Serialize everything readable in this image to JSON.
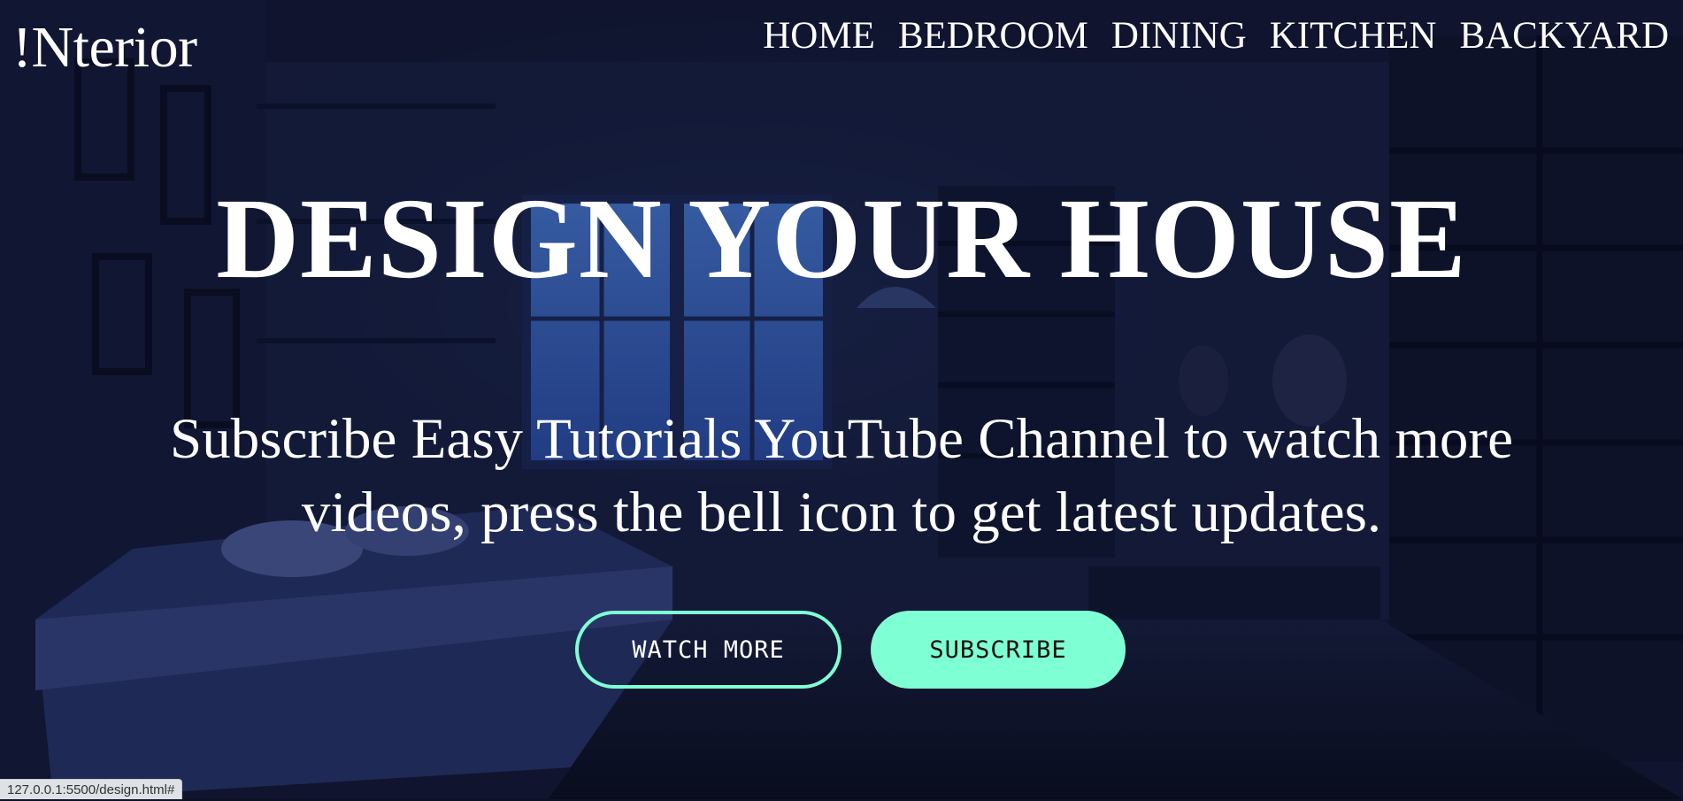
{
  "header": {
    "logo": "!Nterior",
    "nav": [
      {
        "label": "HOME"
      },
      {
        "label": "BEDROOM"
      },
      {
        "label": "DINING"
      },
      {
        "label": "KITCHEN"
      },
      {
        "label": "BACKYARD"
      }
    ]
  },
  "hero": {
    "title": "DESIGN YOUR HOUSE",
    "subtitle_line1": "Subscribe Easy Tutorials YouTube Channel to watch more",
    "subtitle_line2": "videos, press the bell icon to get latest updates.",
    "buttons": {
      "watch_more": "WATCH MORE",
      "subscribe": "SUBSCRIBE"
    }
  },
  "status_bar": {
    "url": "127.0.0.1:5500/design.html#"
  },
  "colors": {
    "accent": "#7fffd4",
    "text": "#ffffff",
    "overlay": "#0d1226"
  }
}
